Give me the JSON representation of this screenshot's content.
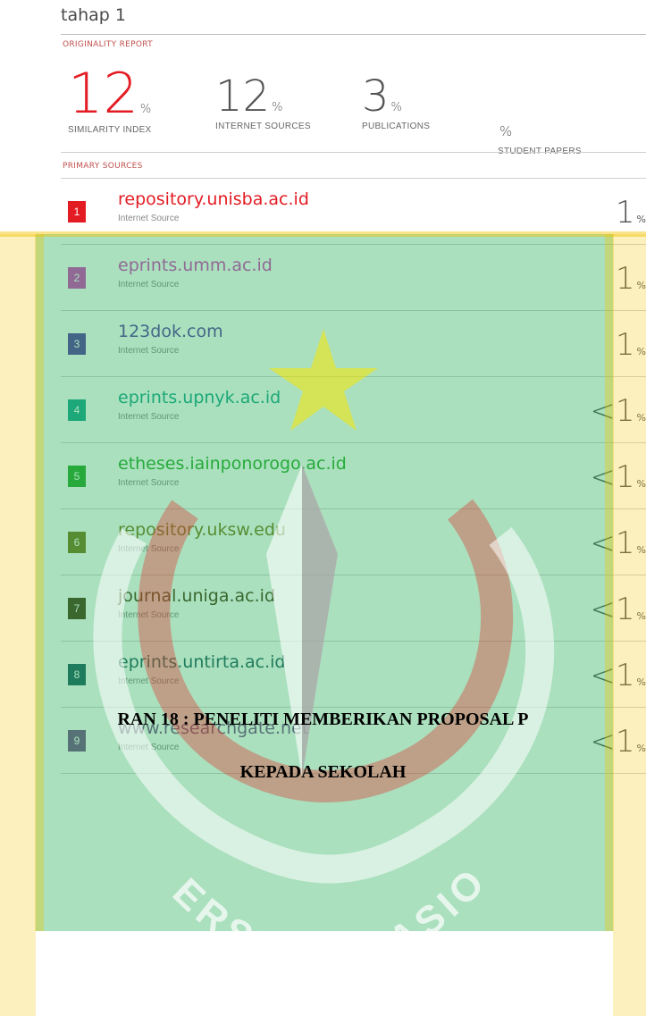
{
  "report": {
    "title": "tahap 1",
    "originality_label": "ORIGINALITY REPORT",
    "primary_sources_label": "PRIMARY SOURCES",
    "stats": [
      {
        "value": "12",
        "unit": "%",
        "label": "SIMILARITY INDEX"
      },
      {
        "value": "12",
        "unit": "%",
        "label": "INTERNET SOURCES"
      },
      {
        "value": "3",
        "unit": "%",
        "label": "PUBLICATIONS"
      },
      {
        "value": "",
        "unit": "%",
        "label": "STUDENT PAPERS"
      }
    ],
    "sources": [
      {
        "rank": "1",
        "domain": "repository.unisba.ac.id",
        "type": "Internet Source",
        "percent": "1",
        "unit": "%",
        "color": "#e31b23"
      },
      {
        "rank": "2",
        "domain": "eprints.umm.ac.id",
        "type": "Internet Source",
        "percent": "1",
        "unit": "%",
        "color": "#d63fbd"
      },
      {
        "rank": "3",
        "domain": "123dok.com",
        "type": "Internet Source",
        "percent": "1",
        "unit": "%",
        "color": "#5a3aa6"
      },
      {
        "rank": "4",
        "domain": "eprints.upnyk.ac.id",
        "type": "Internet Source",
        "percent": "<1",
        "unit": "%",
        "color": "#1aa58f"
      },
      {
        "rank": "5",
        "domain": "etheses.iainponorogo.ac.id",
        "type": "Internet Source",
        "percent": "<1",
        "unit": "%",
        "color": "#2ca92c"
      },
      {
        "rank": "6",
        "domain": "repository.uksw.edu",
        "type": "Internet Source",
        "percent": "<1",
        "unit": "%",
        "color": "#7a7a1e"
      },
      {
        "rank": "7",
        "domain": "journal.uniga.ac.id",
        "type": "Internet Source",
        "percent": "<1",
        "unit": "%",
        "color": "#4a3c18"
      },
      {
        "rank": "8",
        "domain": "eprints.untirta.ac.id",
        "type": "Internet Source",
        "percent": "<1",
        "unit": "%",
        "color": "#1e5c62"
      },
      {
        "rank": "9",
        "domain": "www.researchgate.net",
        "type": "Internet Source",
        "percent": "<1",
        "unit": "%",
        "color": "#7a4e8c"
      }
    ]
  },
  "caption": {
    "line1": "RAN 18 : PENELITI MEMBERIKAN PROPOSAL P",
    "line2": "KEPADA SEKOLAH"
  },
  "watermark": {
    "arc_text": "UNIVERSITAS NASIONAL",
    "colors": {
      "green": "#1fae54",
      "gold": "#f2c200",
      "red": "#e0342c",
      "star": "#f7e600"
    }
  }
}
